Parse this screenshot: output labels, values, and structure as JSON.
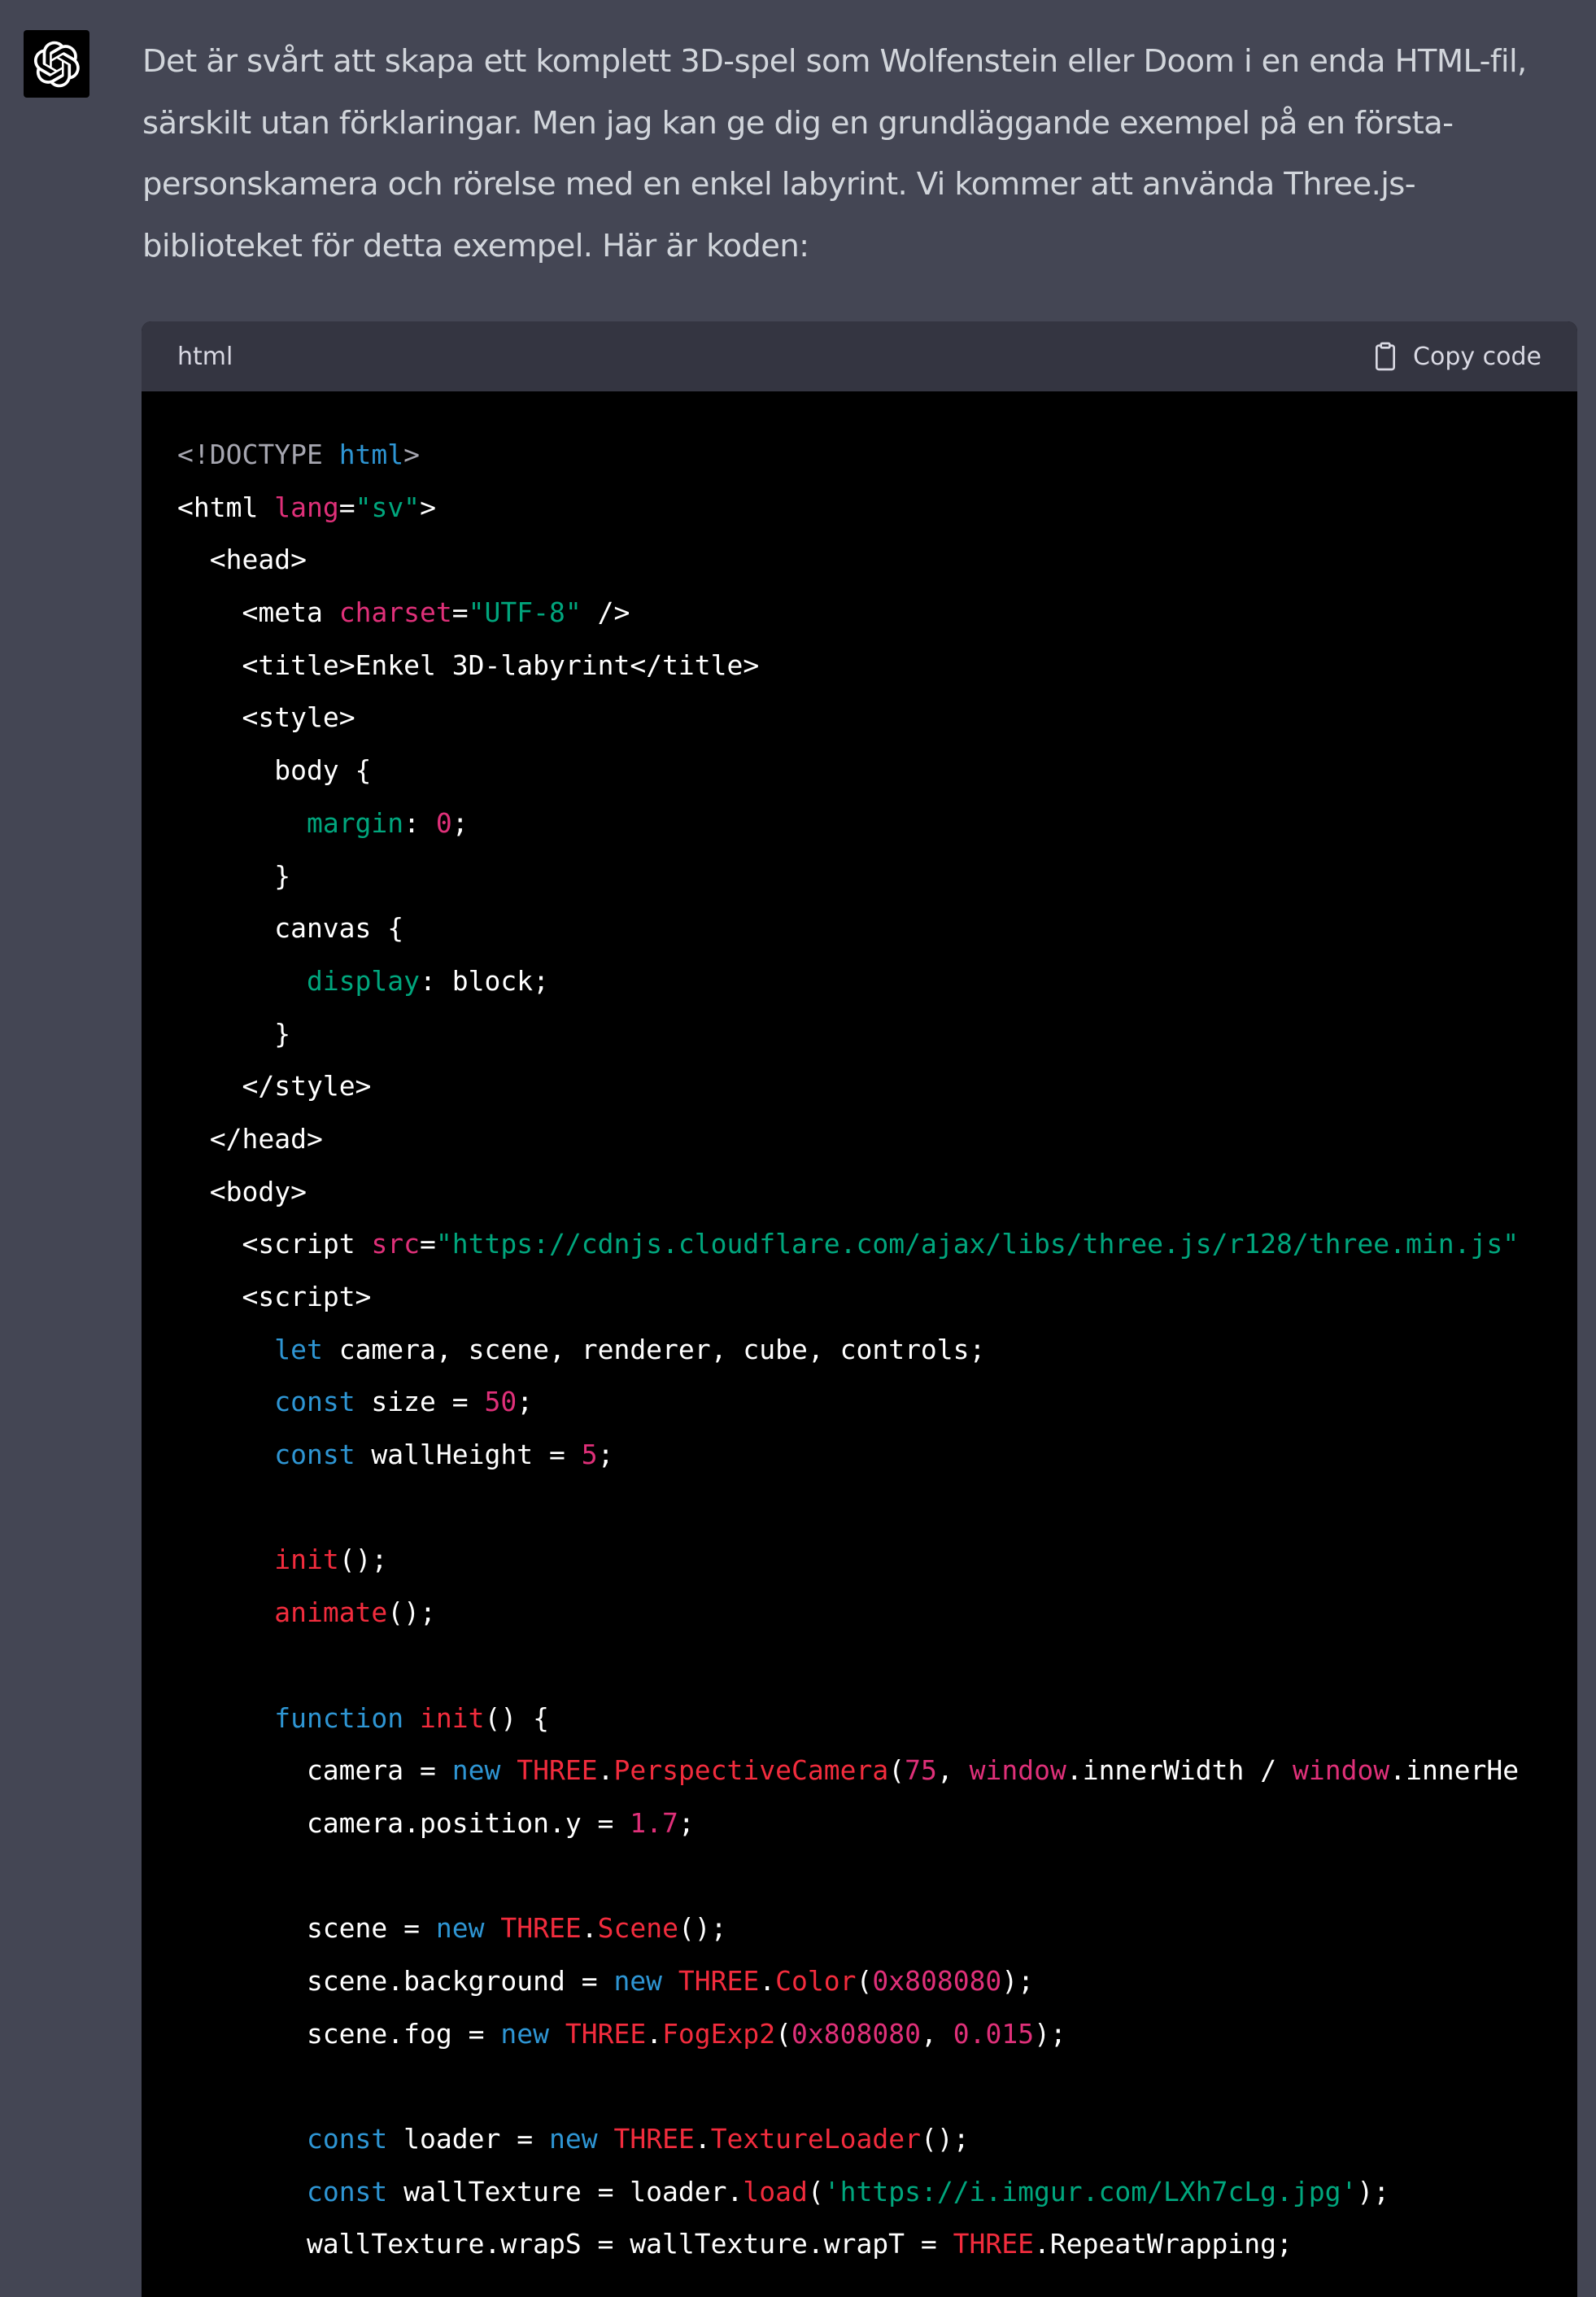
{
  "assistant": {
    "avatar_icon": "openai-logo-icon",
    "message_lines": [
      "Det är svårt att skapa ett komplett 3D-spel som Wolfenstein eller Doom i en enda HTML-fil,",
      "särskilt utan förklaringar. Men jag kan ge dig en grundläggande exempel på en första-",
      "personskamera och rörelse med en enkel labyrint. Vi kommer att använda Three.js-",
      "biblioteket för detta exempel. Här är koden:"
    ]
  },
  "code_block": {
    "language": "html",
    "copy_label": "Copy code",
    "copy_icon": "clipboard-icon",
    "lines": [
      [
        [
          "muted",
          "<!DOCTYPE "
        ],
        [
          "tagname",
          "html"
        ],
        [
          "muted",
          ">"
        ]
      ],
      [
        [
          "tag",
          "<html "
        ],
        [
          "attr",
          "lang"
        ],
        [
          "plain",
          "="
        ],
        [
          "str",
          "\"sv\""
        ],
        [
          "tag",
          ">"
        ]
      ],
      [
        [
          "plain",
          "  "
        ],
        [
          "tag",
          "<head>"
        ]
      ],
      [
        [
          "plain",
          "    "
        ],
        [
          "tag",
          "<meta "
        ],
        [
          "attr",
          "charset"
        ],
        [
          "plain",
          "="
        ],
        [
          "str",
          "\"UTF-8\""
        ],
        [
          "tag",
          " />"
        ]
      ],
      [
        [
          "plain",
          "    "
        ],
        [
          "tag",
          "<title>"
        ],
        [
          "plain",
          "Enkel 3D-labyrint"
        ],
        [
          "tag",
          "</title>"
        ]
      ],
      [
        [
          "plain",
          "    "
        ],
        [
          "tag",
          "<style>"
        ]
      ],
      [
        [
          "plain",
          "      body {"
        ]
      ],
      [
        [
          "plain",
          "        "
        ],
        [
          "prop",
          "margin"
        ],
        [
          "plain",
          ": "
        ],
        [
          "num",
          "0"
        ],
        [
          "plain",
          ";"
        ]
      ],
      [
        [
          "plain",
          "      }"
        ]
      ],
      [
        [
          "plain",
          "      canvas {"
        ]
      ],
      [
        [
          "plain",
          "        "
        ],
        [
          "prop",
          "display"
        ],
        [
          "plain",
          ": block;"
        ]
      ],
      [
        [
          "plain",
          "      }"
        ]
      ],
      [
        [
          "plain",
          "    "
        ],
        [
          "tag",
          "</style>"
        ]
      ],
      [
        [
          "plain",
          "  "
        ],
        [
          "tag",
          "</head>"
        ]
      ],
      [
        [
          "plain",
          "  "
        ],
        [
          "tag",
          "<body>"
        ]
      ],
      [
        [
          "plain",
          "    "
        ],
        [
          "tag",
          "<script "
        ],
        [
          "attr",
          "src"
        ],
        [
          "plain",
          "="
        ],
        [
          "str",
          "\"https://cdnjs.cloudflare.com/ajax/libs/three.js/r128/three.min.js\""
        ]
      ],
      [
        [
          "plain",
          "    "
        ],
        [
          "tag",
          "<script>"
        ]
      ],
      [
        [
          "plain",
          "      "
        ],
        [
          "key",
          "let"
        ],
        [
          "plain",
          " camera, scene, renderer, cube, controls;"
        ]
      ],
      [
        [
          "plain",
          "      "
        ],
        [
          "key",
          "const"
        ],
        [
          "plain",
          " size = "
        ],
        [
          "num",
          "50"
        ],
        [
          "plain",
          ";"
        ]
      ],
      [
        [
          "plain",
          "      "
        ],
        [
          "key",
          "const"
        ],
        [
          "plain",
          " wallHeight = "
        ],
        [
          "num",
          "5"
        ],
        [
          "plain",
          ";"
        ]
      ],
      [
        [
          "plain",
          ""
        ]
      ],
      [
        [
          "plain",
          "      "
        ],
        [
          "fn",
          "init"
        ],
        [
          "plain",
          "();"
        ]
      ],
      [
        [
          "plain",
          "      "
        ],
        [
          "fn",
          "animate"
        ],
        [
          "plain",
          "();"
        ]
      ],
      [
        [
          "plain",
          ""
        ]
      ],
      [
        [
          "plain",
          "      "
        ],
        [
          "key",
          "function"
        ],
        [
          "plain",
          " "
        ],
        [
          "fn",
          "init"
        ],
        [
          "plain",
          "() {"
        ]
      ],
      [
        [
          "plain",
          "        camera = "
        ],
        [
          "key",
          "new"
        ],
        [
          "plain",
          " "
        ],
        [
          "cls",
          "THREE"
        ],
        [
          "plain",
          "."
        ],
        [
          "cls",
          "PerspectiveCamera"
        ],
        [
          "plain",
          "("
        ],
        [
          "num",
          "75"
        ],
        [
          "plain",
          ", "
        ],
        [
          "glob",
          "window"
        ],
        [
          "plain",
          ".innerWidth / "
        ],
        [
          "glob",
          "window"
        ],
        [
          "plain",
          ".innerHe"
        ]
      ],
      [
        [
          "plain",
          "        camera.position.y = "
        ],
        [
          "num",
          "1.7"
        ],
        [
          "plain",
          ";"
        ]
      ],
      [
        [
          "plain",
          ""
        ]
      ],
      [
        [
          "plain",
          "        scene = "
        ],
        [
          "key",
          "new"
        ],
        [
          "plain",
          " "
        ],
        [
          "cls",
          "THREE"
        ],
        [
          "plain",
          "."
        ],
        [
          "cls",
          "Scene"
        ],
        [
          "plain",
          "();"
        ]
      ],
      [
        [
          "plain",
          "        scene.background = "
        ],
        [
          "key",
          "new"
        ],
        [
          "plain",
          " "
        ],
        [
          "cls",
          "THREE"
        ],
        [
          "plain",
          "."
        ],
        [
          "cls",
          "Color"
        ],
        [
          "plain",
          "("
        ],
        [
          "num",
          "0x808080"
        ],
        [
          "plain",
          ");"
        ]
      ],
      [
        [
          "plain",
          "        scene.fog = "
        ],
        [
          "key",
          "new"
        ],
        [
          "plain",
          " "
        ],
        [
          "cls",
          "THREE"
        ],
        [
          "plain",
          "."
        ],
        [
          "cls",
          "FogExp2"
        ],
        [
          "plain",
          "("
        ],
        [
          "num",
          "0x808080"
        ],
        [
          "plain",
          ", "
        ],
        [
          "num",
          "0.015"
        ],
        [
          "plain",
          ");"
        ]
      ],
      [
        [
          "plain",
          ""
        ]
      ],
      [
        [
          "plain",
          "        "
        ],
        [
          "key",
          "const"
        ],
        [
          "plain",
          " loader = "
        ],
        [
          "key",
          "new"
        ],
        [
          "plain",
          " "
        ],
        [
          "cls",
          "THREE"
        ],
        [
          "plain",
          "."
        ],
        [
          "cls",
          "TextureLoader"
        ],
        [
          "plain",
          "();"
        ]
      ],
      [
        [
          "plain",
          "        "
        ],
        [
          "key",
          "const"
        ],
        [
          "plain",
          " wallTexture = loader."
        ],
        [
          "fn",
          "load"
        ],
        [
          "plain",
          "("
        ],
        [
          "str",
          "'https://i.imgur.com/LXh7cLg.jpg'"
        ],
        [
          "plain",
          ");"
        ]
      ],
      [
        [
          "plain",
          "        wallTexture.wrapS = wallTexture.wrapT = "
        ],
        [
          "cls",
          "THREE"
        ],
        [
          "plain",
          ".RepeatWrapping;"
        ]
      ]
    ]
  }
}
